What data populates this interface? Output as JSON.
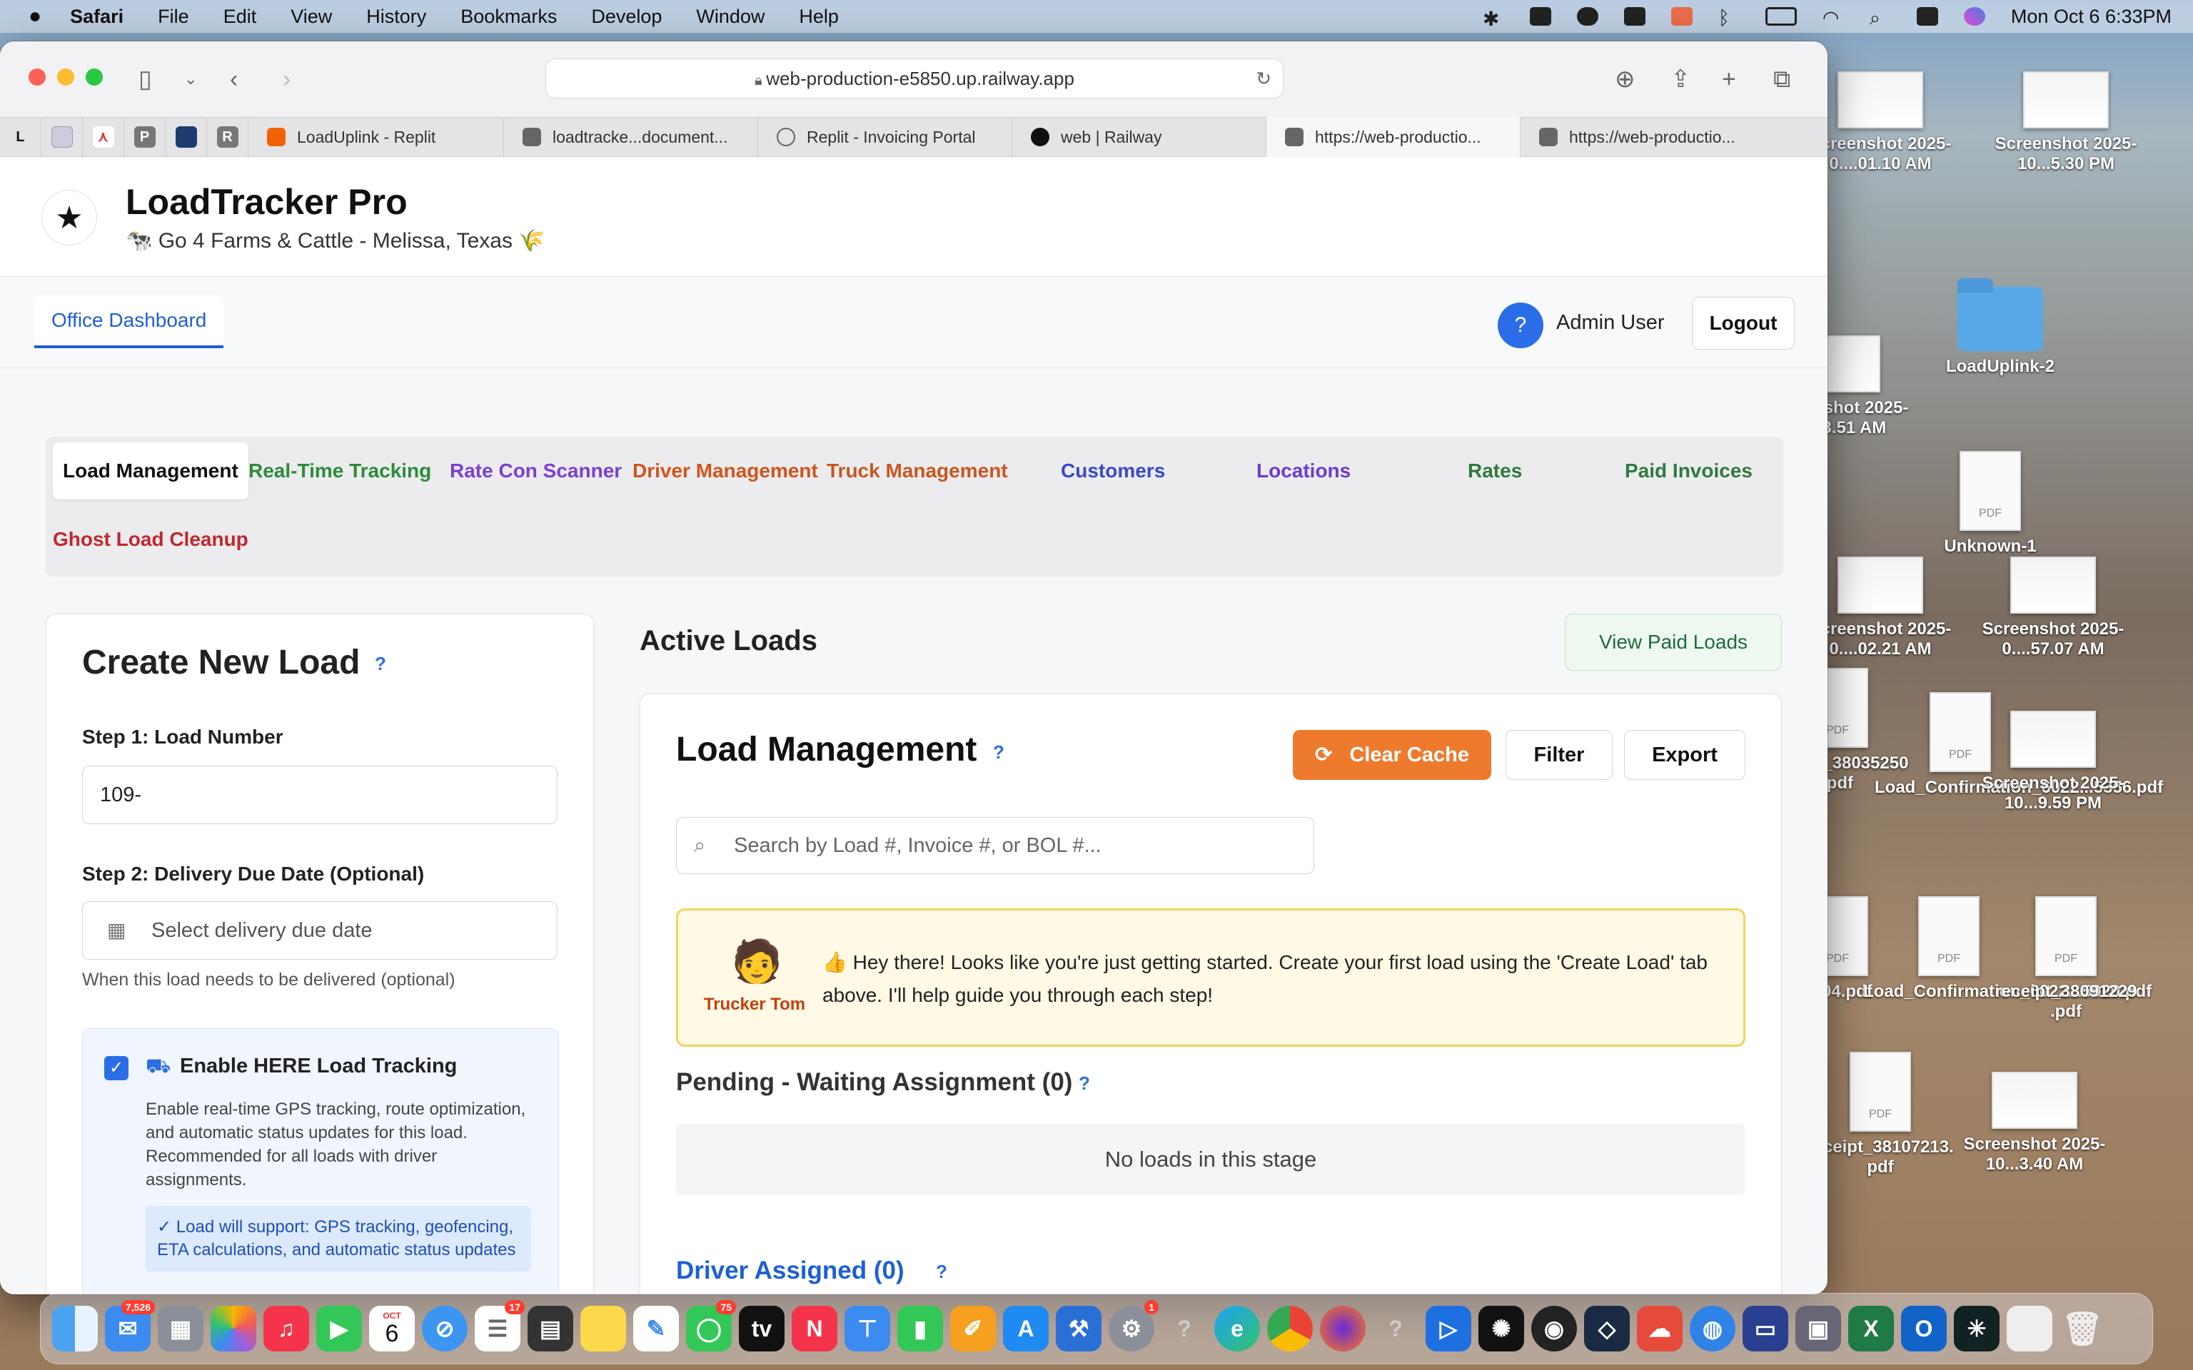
{
  "menubar": {
    "app": "Safari",
    "items": [
      "File",
      "Edit",
      "View",
      "History",
      "Bookmarks",
      "Develop",
      "Window",
      "Help"
    ],
    "datetime": "Mon Oct 6  6:33PM"
  },
  "browser": {
    "url": "web-production-e5850.up.railway.app",
    "pinned_tabs": [
      "L",
      "",
      "",
      "P",
      "",
      "R"
    ],
    "tabs": [
      {
        "label": "LoadUplink - Replit"
      },
      {
        "label": "loadtracke...document..."
      },
      {
        "label": "Replit - Invoicing Portal"
      },
      {
        "label": "web | Railway"
      },
      {
        "label": "https://web-productio..."
      },
      {
        "label": "https://web-productio..."
      }
    ]
  },
  "app": {
    "title": "LoadTracker Pro",
    "subtitle": "🐄 Go 4 Farms & Cattle - Melissa, Texas 🌾",
    "office_dashboard": "Office Dashboard",
    "user": "Admin User",
    "logout": "Logout",
    "nav_tabs": [
      {
        "label": "Load Management",
        "color": "#111111"
      },
      {
        "label": "Real-Time Tracking",
        "color": "#2e8b3a"
      },
      {
        "label": "Rate Con Scanner",
        "color": "#7b3fd1"
      },
      {
        "label": "Driver Management",
        "color": "#d2541a"
      },
      {
        "label": "Truck Management",
        "color": "#c8571d"
      },
      {
        "label": "Customers",
        "color": "#3a49c9"
      },
      {
        "label": "Locations",
        "color": "#6b3ccf"
      },
      {
        "label": "Rates",
        "color": "#2f7a3c"
      },
      {
        "label": "Paid Invoices",
        "color": "#2f7a3c"
      },
      {
        "label": "Ghost Load Cleanup",
        "color": "#c0282d"
      }
    ]
  },
  "create_load": {
    "title": "Create New Load",
    "help": "?",
    "step1_label": "Step 1: Load Number",
    "step1_value": "109-",
    "step2_label": "Step 2: Delivery Due Date (Optional)",
    "step2_placeholder": "Select delivery due date",
    "step2_hint": "When this load needs to be delivered (optional)",
    "tracking_label": "Enable HERE Load Tracking",
    "tracking_checked": true,
    "tracking_desc": "Enable real-time GPS tracking, route optimization, and automatic status updates for this load. Recommended for all loads with driver assignments.",
    "tracking_note": "✓ Load will support: GPS tracking, geofencing, ETA calculations, and automatic status updates"
  },
  "active_loads": {
    "title": "Active Loads",
    "view_paid": "View Paid Loads",
    "card_title": "Load Management",
    "help": "?",
    "clear_cache": "Clear Cache",
    "filter": "Filter",
    "export": "Export",
    "search_placeholder": "Search by Load #, Invoice #, or BOL #...",
    "tip_name": "Trucker Tom",
    "tip_text": "👍 Hey there! Looks like you're just getting started. Create your first load using the 'Create Load' tab above. I'll help guide you through each step!",
    "pending_title": "Pending - Waiting Assignment (0)",
    "empty_text": "No loads in this stage",
    "assigned_title": "Driver Assigned (0)"
  },
  "desktop": [
    {
      "label": "Screenshot 2025-0....01.10 AM",
      "kind": "shot"
    },
    {
      "label": "Screenshot 2025-10...5.30 PM",
      "kind": "shot"
    },
    {
      "label": "Screenshot 2025-0...33.51 AM",
      "kind": "shot"
    },
    {
      "label": "LoadUplink-2",
      "kind": "folder"
    },
    {
      "label": "Unknown-1",
      "kind": "doc"
    },
    {
      "label": "Screenshot 2025-0....02.21 AM",
      "kind": "shot"
    },
    {
      "label": "Screenshot 2025-0....57.07 AM",
      "kind": "shot"
    },
    {
      "label": "receipt_38035250 .pdf",
      "kind": "doc"
    },
    {
      "label": "Load_Confirmation_6022...5356.pdf",
      "kind": "doc"
    },
    {
      "label": "Screenshot 2025-10...9.59 PM",
      "kind": "shot"
    },
    {
      "label": "2404.pdf",
      "kind": "doc"
    },
    {
      "label": "Load_Confirmation_6022...5020.pdf",
      "kind": "doc"
    },
    {
      "label": "receipt_38091229 .pdf",
      "kind": "doc"
    },
    {
      "label": "receipt_38107213. pdf",
      "kind": "doc"
    },
    {
      "label": "Screenshot 2025-10...3.40 AM",
      "kind": "shot"
    }
  ],
  "dock": {
    "mail_badge": "7,526",
    "calendar_month": "OCT",
    "calendar_day": "6",
    "reminders_badge": "17",
    "messages_badge": "75",
    "settings_badge": "1"
  }
}
